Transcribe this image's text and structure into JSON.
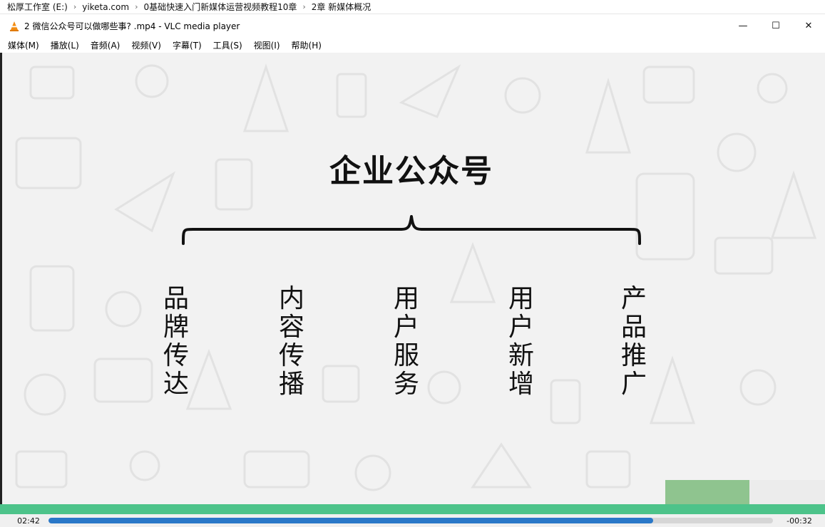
{
  "breadcrumb": {
    "items": [
      "松厚工作室 (E:)",
      "yiketa.com",
      "0基础快速入门新媒体运营视频教程10章",
      "2章 新媒体概况"
    ],
    "separator": "›"
  },
  "window": {
    "title": "2 微信公众号可以做哪些事? .mp4 - VLC media player",
    "app_icon": "vlc-cone-icon",
    "minimize_glyph": "—",
    "maximize_glyph": "☐",
    "close_glyph": "✕"
  },
  "menu": {
    "items": [
      "媒体(M)",
      "播放(L)",
      "音频(A)",
      "视频(V)",
      "字幕(T)",
      "工具(S)",
      "视图(I)",
      "帮助(H)"
    ]
  },
  "slide": {
    "title": "企业公众号",
    "branches": [
      "品牌传达",
      "内容传播",
      "用户服务",
      "用户新增",
      "产品推广"
    ]
  },
  "player": {
    "elapsed": "02:42",
    "remaining": "-00:32",
    "progress": 0.835
  },
  "colors": {
    "accent_strip": "#4dc38a",
    "seek_fill": "#2a78c8",
    "vlc_orange": "#f28c12"
  }
}
